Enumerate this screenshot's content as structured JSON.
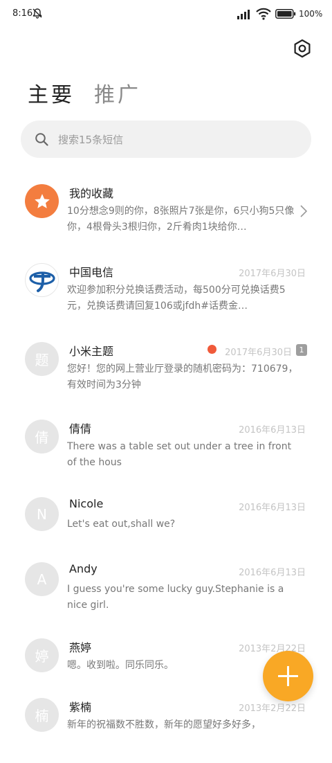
{
  "status_bar": {
    "time": "8:16",
    "battery": "100%"
  },
  "tabs": [
    {
      "label": "主要",
      "active": true
    },
    {
      "label": "推广",
      "active": false
    }
  ],
  "search": {
    "placeholder": "搜索15条短信"
  },
  "conversations": [
    {
      "name": "我的收藏",
      "date": "",
      "preview": "10分想念9则的你，8张照片7张是你，6只小狗5只像你，4根骨头3根归你，2斤肴肉1块给你…",
      "avatar_text": "",
      "avatar_icon": "star-icon"
    },
    {
      "name": "中国电信",
      "date": "2017年6月30日",
      "preview": "欢迎参加积分兑换话费活动，每500分可兑换话费5元，兑换话费请回复106或jfdh#话费金…",
      "avatar_text": "",
      "avatar_icon": "china-telecom-logo"
    },
    {
      "name": "小米主题",
      "date": "2017年6月30日",
      "preview": "您好！您的网上营业厅登录的随机密码为：710679，有效时间为3分钟",
      "avatar_text": "题",
      "sim_badge": "1"
    },
    {
      "name": "倩倩",
      "date": "2016年6月13日",
      "preview": "There was a table set out under a tree in front of the hous",
      "avatar_text": "倩"
    },
    {
      "name": "Nicole",
      "date": "2016年6月13日",
      "preview": "Let's eat out,shall we?",
      "avatar_text": "N"
    },
    {
      "name": "Andy",
      "date": "2016年6月13日",
      "preview": "I guess you're some lucky guy.Stephanie is a nice girl.",
      "avatar_text": "A"
    },
    {
      "name": "燕婷",
      "date": "2013年2月22日",
      "preview": "嗯。收到啦。同乐同乐。",
      "avatar_text": "婷"
    },
    {
      "name": "紫楠",
      "date": "2013年2月22日",
      "preview": "新年的祝福数不胜数，新年的愿望好多好多，",
      "avatar_text": "楠"
    }
  ],
  "colors": {
    "accent": "#f9a825",
    "favorites": "#f37d3f",
    "alert": "#f05a3a",
    "telecom_blue": "#1d5fa8"
  }
}
